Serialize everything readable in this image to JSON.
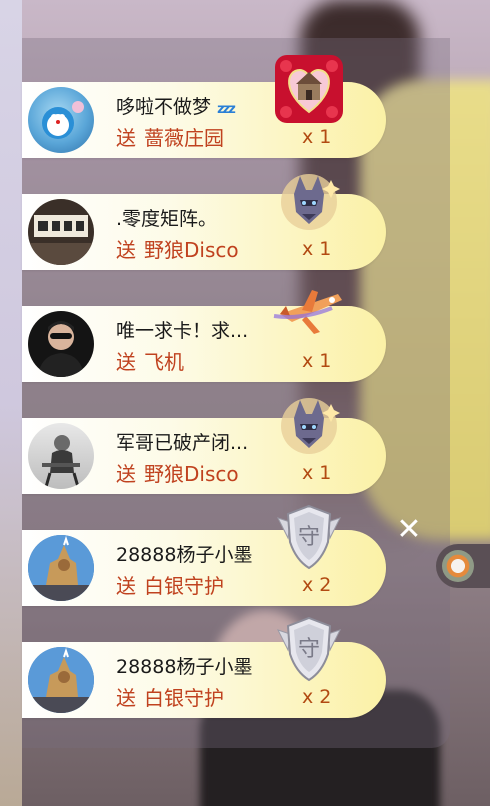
{
  "gifts": [
    {
      "user": "哆啦不做梦",
      "gift_verb": "送",
      "gift": "蔷薇庄园",
      "count": "x 1",
      "gift_icon": "rose-manor-icon",
      "user_emoji": "zzz"
    },
    {
      "user": ".零度矩阵。",
      "gift_verb": "送",
      "gift": "野狼Disco",
      "count": "x 1",
      "gift_icon": "wolf-disco-icon"
    },
    {
      "user": "唯一求卡！求...",
      "gift_verb": "送",
      "gift": "飞机",
      "count": "x 1",
      "gift_icon": "airplane-icon"
    },
    {
      "user": "军哥已破产闭...",
      "gift_verb": "送",
      "gift": "野狼Disco",
      "count": "x 1",
      "gift_icon": "wolf-disco-icon"
    },
    {
      "user": "28888杨子小墨",
      "gift_verb": "送",
      "gift": "白银守护",
      "count": "x 2",
      "gift_icon": "silver-guard-shield-icon",
      "shield_char": "守"
    },
    {
      "user": "28888杨子小墨",
      "gift_verb": "送",
      "gift": "白银守护",
      "count": "x 2",
      "gift_icon": "silver-guard-shield-icon",
      "shield_char": "守"
    }
  ],
  "close_label": "✕",
  "colors": {
    "banner_end": "#fbf1a6",
    "gift_text": "#c0421f",
    "count_text": "#b24a12"
  }
}
